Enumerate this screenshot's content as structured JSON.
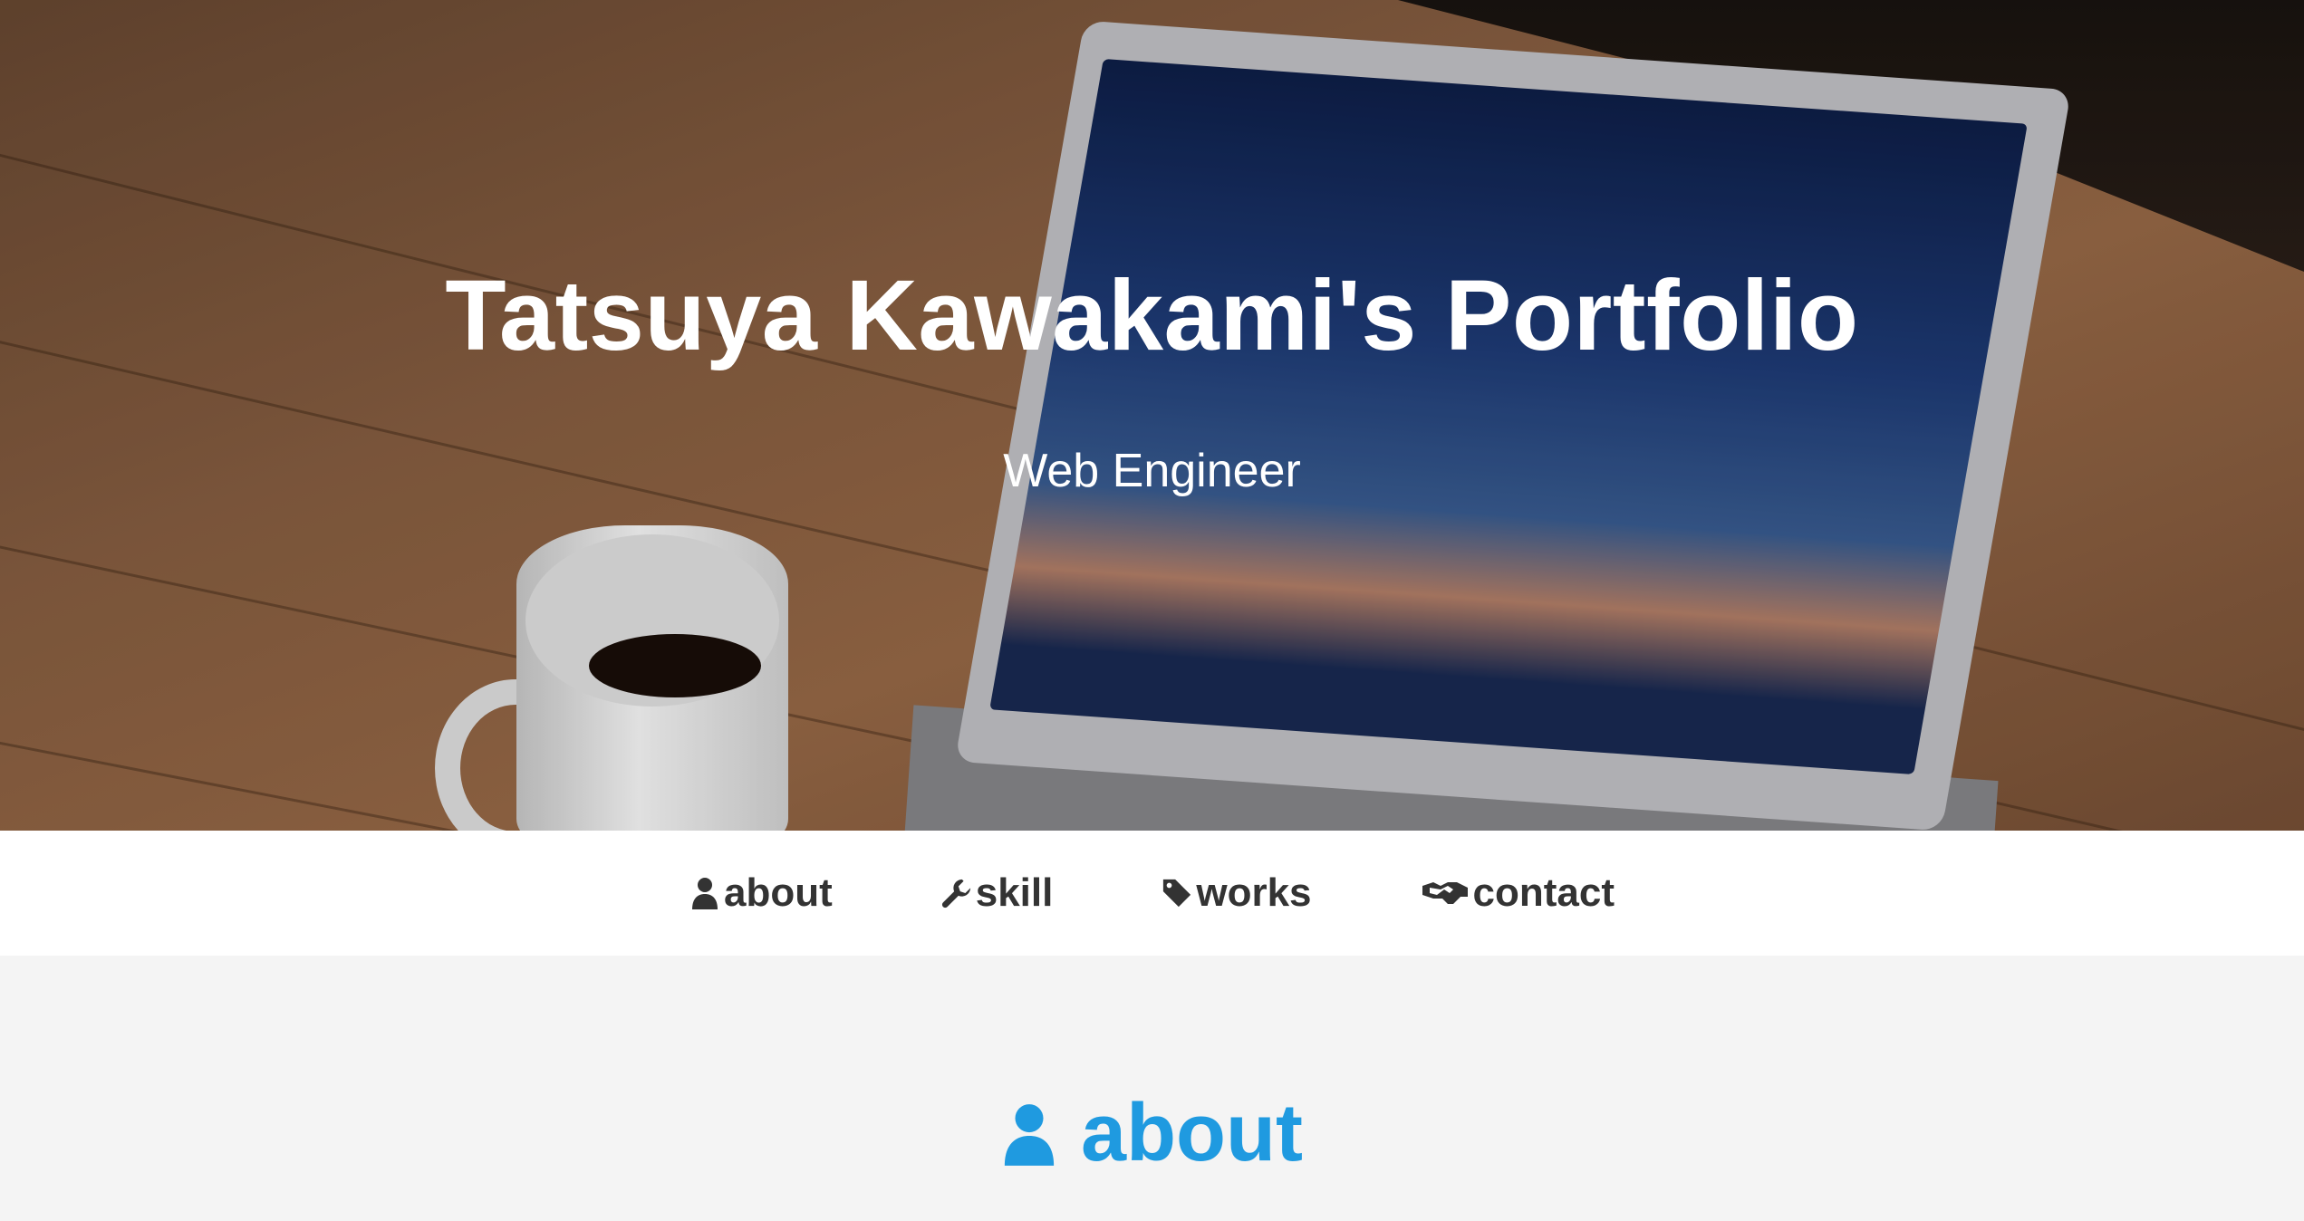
{
  "hero": {
    "title": "Tatsuya Kawakami's Portfolio",
    "subtitle": "Web Engineer"
  },
  "nav": {
    "items": [
      {
        "label": "about",
        "icon": "user-icon"
      },
      {
        "label": "skill",
        "icon": "wrench-icon"
      },
      {
        "label": "works",
        "icon": "tag-icon"
      },
      {
        "label": "contact",
        "icon": "handshake-icon"
      }
    ]
  },
  "section": {
    "title": "about",
    "icon": "user-icon"
  },
  "colors": {
    "accent": "#1f9ae0",
    "nav_text": "#333333",
    "page_bg": "#f4f4f4"
  }
}
